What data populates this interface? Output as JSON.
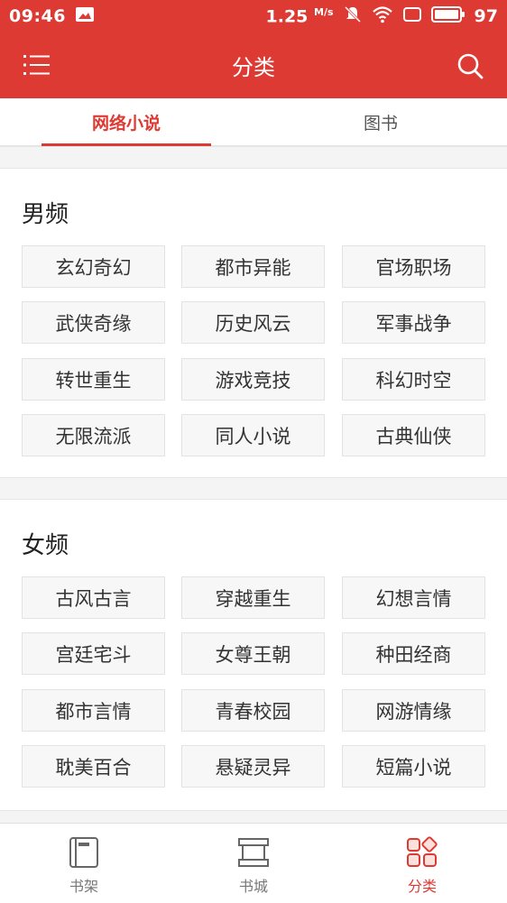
{
  "status_bar": {
    "time": "09:46",
    "speed": "1.25",
    "speed_unit": "M/s",
    "battery": "97"
  },
  "header": {
    "title": "分类",
    "menu_icon": "menu-icon",
    "search_icon": "search-icon"
  },
  "tabs": [
    {
      "label": "网络小说",
      "active": true
    },
    {
      "label": "图书",
      "active": false
    }
  ],
  "sections": [
    {
      "title": "男频",
      "items": [
        "玄幻奇幻",
        "都市异能",
        "官场职场",
        "武侠奇缘",
        "历史风云",
        "军事战争",
        "转世重生",
        "游戏竞技",
        "科幻时空",
        "无限流派",
        "同人小说",
        "古典仙侠"
      ]
    },
    {
      "title": "女频",
      "items": [
        "古风古言",
        "穿越重生",
        "幻想言情",
        "宫廷宅斗",
        "女尊王朝",
        "种田经商",
        "都市言情",
        "青春校园",
        "网游情缘",
        "耽美百合",
        "悬疑灵异",
        "短篇小说"
      ]
    }
  ],
  "bottom_nav": [
    {
      "label": "书架",
      "icon": "bookshelf-icon",
      "active": false
    },
    {
      "label": "书城",
      "icon": "bookstore-icon",
      "active": false
    },
    {
      "label": "分类",
      "icon": "category-icon",
      "active": true
    }
  ],
  "colors": {
    "accent": "#dd3a33",
    "chip_bg": "#f7f7f7",
    "gap_bg": "#f4f4f4"
  }
}
